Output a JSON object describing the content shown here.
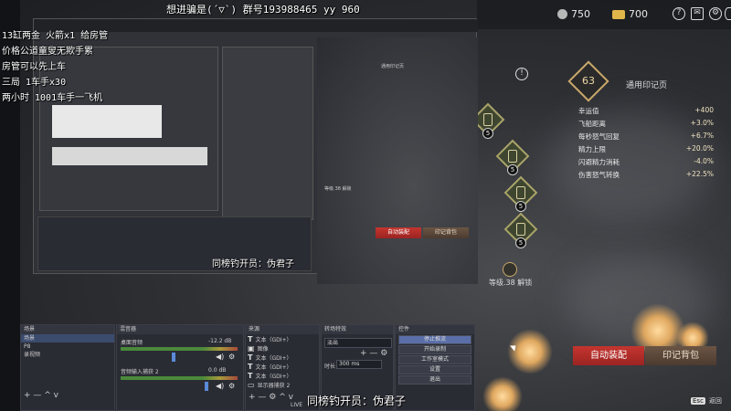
{
  "stream_overlay": {
    "title_line": "想进骗是(´▽`) 群号193988465 yy 960",
    "notes": [
      "13缸两金 火箭x1 给房管",
      "价格公道童叟无欺手累",
      "房管可以先上车",
      "三局 1车手x30",
      "两小时 1001车手一飞机"
    ],
    "bottom_caption": "同榜钓开员：伪君子"
  },
  "game": {
    "resources": [
      {
        "icon": "gear-currency-icon",
        "value": "750"
      },
      {
        "icon": "gold-bar-icon",
        "value": "700"
      }
    ],
    "top_icons": [
      "help-icon",
      "mail-icon",
      "settings-icon",
      "user-icon"
    ],
    "level": "63",
    "panel_title": "通用印记页",
    "stats": [
      {
        "label": "幸运值",
        "value": "+400"
      },
      {
        "label": "飞船距离",
        "value": "+3.0%"
      },
      {
        "label": "每秒怒气回复",
        "value": "+6.7%"
      },
      {
        "label": "精力上限",
        "value": "+20.0%"
      },
      {
        "label": "闪避精力消耗",
        "value": "-4.0%"
      },
      {
        "label": "伤害怒气转换",
        "value": "+22.5%"
      }
    ],
    "rune_counts": [
      "5",
      "5",
      "5",
      "5"
    ],
    "unlock_text": "等级.38 解锁",
    "auto_equip_label": "自动装配",
    "rune_bag_label": "印记背包",
    "esc_key": "Esc",
    "esc_label": "返回"
  },
  "obs": {
    "scenes_title": "场景",
    "scenes": [
      "场景",
      "P8",
      "录视频"
    ],
    "mixer_title": "混音器",
    "mixer": [
      {
        "name": "桌面音频",
        "db": "-12.2 dB"
      },
      {
        "name": "音频输入捕获 2",
        "db": "0.0 dB"
      }
    ],
    "sources_title": "来源",
    "sources": [
      "文本（GDI+）",
      "图像",
      "文本（GDI+）",
      "文本（GDI+）",
      "文本（GDI+）",
      "显示器捕获 2"
    ],
    "transition_title": "转场特效",
    "transition": "淡出",
    "duration_label": "时长",
    "duration_value": "300 ms",
    "controls_title": "控件",
    "controls": [
      "停止推流",
      "开始录制",
      "工作室模式",
      "设置",
      "退出"
    ],
    "live_label": "LIVE"
  }
}
